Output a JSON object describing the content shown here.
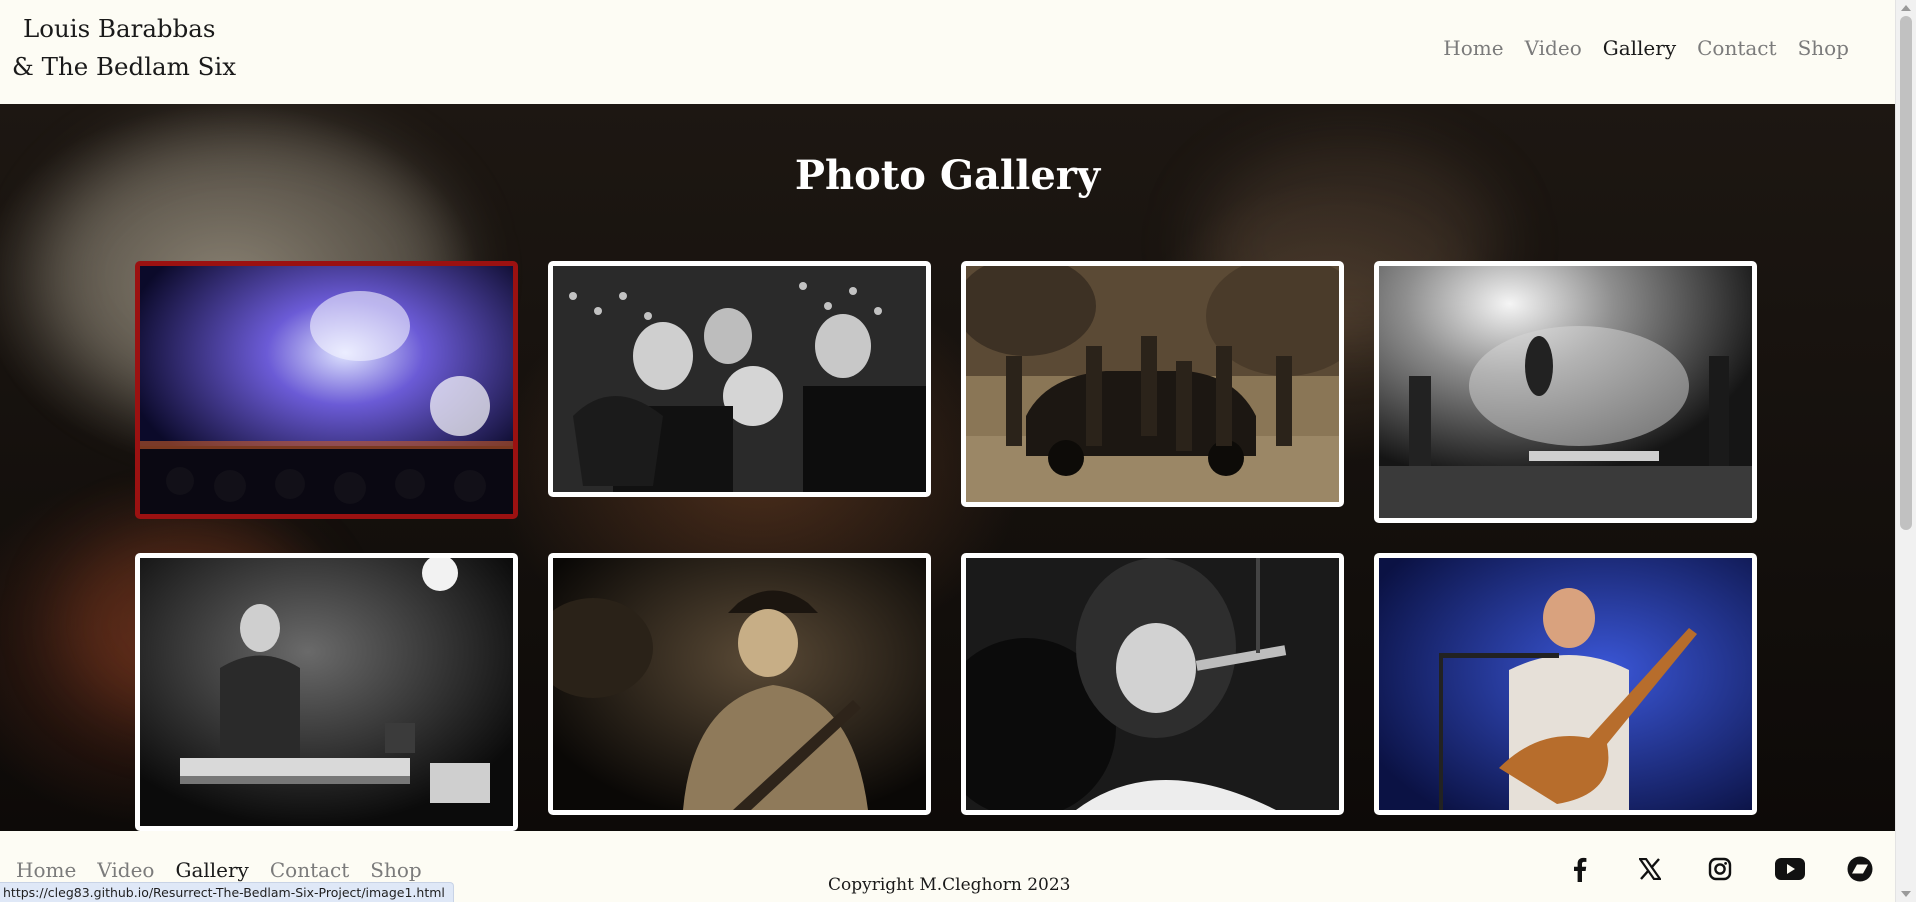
{
  "header": {
    "brand_line1": "Louis Barabbas",
    "brand_line2": "& The Bedlam Six",
    "nav": [
      {
        "label": "Home",
        "active": false
      },
      {
        "label": "Video",
        "active": false
      },
      {
        "label": "Gallery",
        "active": true
      },
      {
        "label": "Contact",
        "active": false
      },
      {
        "label": "Shop",
        "active": false
      }
    ]
  },
  "gallery": {
    "title": "Photo Gallery",
    "photos": [
      {
        "subject": "band on stage under blue lights and smoke",
        "tone": "blue",
        "selected": true
      },
      {
        "subject": "band members on carousel horses",
        "tone": "bw",
        "selected": false
      },
      {
        "subject": "band posing around vintage car",
        "tone": "sepia",
        "selected": false
      },
      {
        "subject": "guitarist jumping on smoky stage",
        "tone": "bw",
        "selected": false
      },
      {
        "subject": "keyboard player singing at Nord piano",
        "tone": "bw",
        "selected": false
      },
      {
        "subject": "singer in hat playing guitar",
        "tone": "sepia",
        "selected": false
      },
      {
        "subject": "bearded singer at microphone",
        "tone": "bw",
        "selected": false
      },
      {
        "subject": "guitarist singing under blue light",
        "tone": "blue",
        "selected": false
      }
    ]
  },
  "footer": {
    "nav": [
      {
        "label": "Home",
        "active": false
      },
      {
        "label": "Video",
        "active": false
      },
      {
        "label": "Gallery",
        "active": true
      },
      {
        "label": "Contact",
        "active": false
      },
      {
        "label": "Shop",
        "active": false
      }
    ],
    "copyright": "Copyright M.Cleghorn 2023",
    "socials": [
      "facebook-icon",
      "x-twitter-icon",
      "instagram-icon",
      "youtube-icon",
      "bandcamp-icon"
    ]
  },
  "status_bar": {
    "url": "https://cleg83.github.io/Resurrect-The-Bedlam-Six-Project/image1.html"
  },
  "colors": {
    "background": "#fdfcf4",
    "text": "#1a1a1a",
    "nav_inactive": "#7b7b7b",
    "selected_border": "#9b1111",
    "photo_border": "#ffffff"
  }
}
